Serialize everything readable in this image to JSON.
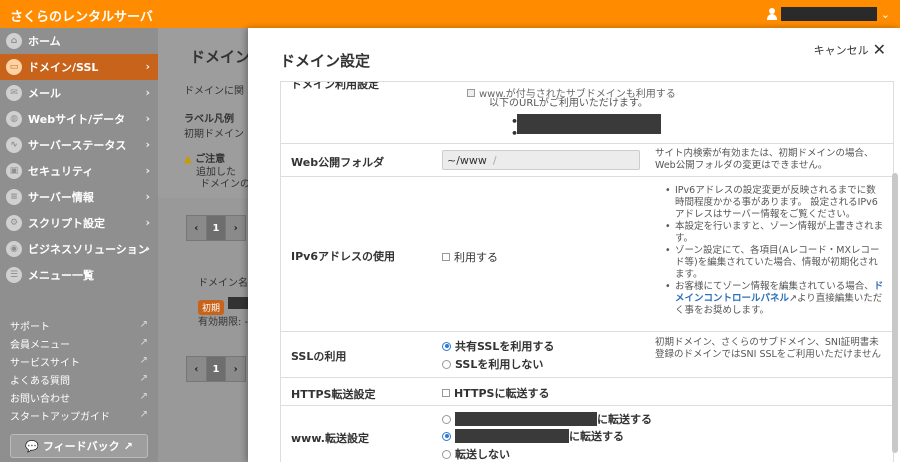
{
  "topbar": {
    "brand": "さくらのレンタルサーバ",
    "user_caret": "⌄"
  },
  "sidebar": {
    "items": [
      {
        "label": "ホーム",
        "icon": "home-icon",
        "glyph": "⌂"
      },
      {
        "label": "ドメイン/SSL",
        "icon": "domain-icon",
        "glyph": "▭",
        "active": true
      },
      {
        "label": "メール",
        "icon": "mail-icon",
        "glyph": "✉"
      },
      {
        "label": "Webサイト/データ",
        "icon": "globe-icon",
        "glyph": "◍"
      },
      {
        "label": "サーバーステータス",
        "icon": "chart-icon",
        "glyph": "∿"
      },
      {
        "label": "セキュリティ",
        "icon": "lock-icon",
        "glyph": "▣"
      },
      {
        "label": "サーバー情報",
        "icon": "server-icon",
        "glyph": "≡"
      },
      {
        "label": "スクリプト設定",
        "icon": "script-icon",
        "glyph": "⚙"
      },
      {
        "label": "ビジネスソリューション",
        "icon": "business-icon",
        "glyph": "◉"
      },
      {
        "label": "メニュー一覧",
        "icon": "menu-icon",
        "glyph": "☰"
      }
    ],
    "links": [
      "サポート",
      "会員メニュー",
      "サービスサイト",
      "よくある質問",
      "お問い合わせ",
      "スタートアップガイド"
    ],
    "feedback_label": "フィードバック"
  },
  "background": {
    "title": "ドメイン",
    "intro": "ドメインに関",
    "label_legend": "ラベル凡例",
    "label_initial": "初期ドメイン",
    "notice_title": "ご注意",
    "notice_1": "追加した",
    "notice_2": "ドメインの",
    "page_current": "1",
    "col_domain": "ドメイン名",
    "badge_initial": "初期",
    "expiry": "有効期限: -"
  },
  "modal": {
    "title": "ドメイン設定",
    "cancel_label": "キャンセル",
    "rows": {
      "domain_use": {
        "label": "ドメイン利用設定",
        "www_sub_option": "www.が付与されたサブドメインも利用する",
        "url_note": "以下のURLがご利用いただけます。"
      },
      "web_folder": {
        "label": "Web公開フォルダ",
        "prefix": "~/www",
        "placeholder": "/",
        "note": "サイト内検索が有効または、初期ドメインの場合、Web公開フォルダの変更はできません。"
      },
      "ipv6": {
        "label": "IPv6アドレスの使用",
        "option": "利用する",
        "notes": [
          "IPv6アドレスの設定変更が反映されるまでに数時間程度かかる事があります。 設定されるIPv6アドレスはサーバー情報をご覧ください。",
          "本設定を行いますと、ゾーン情報が上書きされます。",
          "ゾーン設定にて、各項目(Aレコード・MXレコード等)を編集されていた場合、情報が初期化されます。",
          "お客様にてゾーン情報を編集されている場合、"
        ],
        "link_text": "ドメインコントロールパネル",
        "link_after": "より直接編集いただく事をお奨めします。"
      },
      "ssl": {
        "label": "SSLの利用",
        "option_shared": "共有SSLを利用する",
        "option_none": "SSLを利用しない",
        "selected": "共有SSLを利用する",
        "note": "初期ドメイン、さくらのサブドメイン、SNI証明書未登録のドメインではSNI SSLをご利用いただけません"
      },
      "https": {
        "label": "HTTPS転送設定",
        "option": "HTTPSに転送する"
      },
      "www": {
        "label": "www.転送設定",
        "option_1_suffix": "に転送する",
        "option_2_suffix": "に転送する",
        "option_3": "転送しない",
        "selected": "option_2"
      }
    }
  }
}
